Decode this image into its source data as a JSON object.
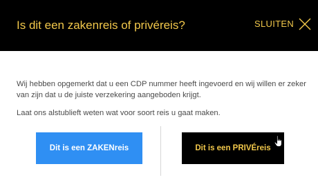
{
  "dialog": {
    "title": "Is dit een zakenreis of privéreis?",
    "close_label": "SLUITEN",
    "close_icon": "close-icon",
    "paragraph_1": "Wij hebben opgemerkt dat u een CDP nummer heeft ingevoerd en wij willen er zeker van zijn dat u de juiste verzekering aangeboden krijgt.",
    "paragraph_2": "Laat ons alstublieft weten wat voor soort reis u gaat maken.",
    "business_button": "Dit is een ZAKENreis",
    "private_button": "Dit is een PRIVÉreis",
    "cursor_icon": "hand-pointer-icon"
  },
  "colors": {
    "header_bg": "#000000",
    "accent_gold": "#f2c84b",
    "business_blue": "#2f8ff3",
    "body_text": "#4a4a4a",
    "divider": "#d6d6d6"
  }
}
